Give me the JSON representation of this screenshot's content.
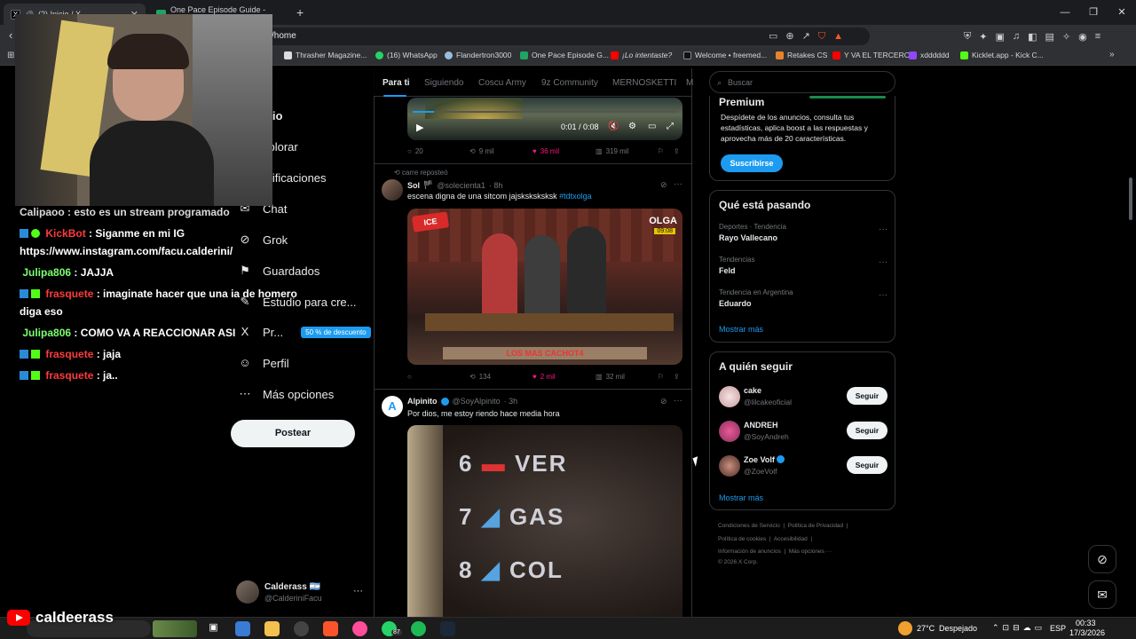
{
  "browser": {
    "tabs": [
      {
        "title": "(2) Inicio / X",
        "active": true
      },
      {
        "title": "One Pace Episode Guide - Google D",
        "active": false
      }
    ],
    "address": "/home",
    "bookmarks": [
      "Thrasher Magazine...",
      "(16) WhatsApp",
      "Flandertron3000",
      "One Pace Episode G...",
      "¡Lo intentaste?",
      "Welcome • freemed...",
      "Retakes CS",
      "Y VA EL TERCERO",
      "xdddddd",
      "Kicklet.app - Kick C..."
    ]
  },
  "nav": {
    "items": [
      {
        "label": "icio",
        "icon": "home-icon"
      },
      {
        "label": "xplorar",
        "icon": "search-icon"
      },
      {
        "label": "otificaciones",
        "icon": "bell-icon"
      },
      {
        "label": "Chat",
        "icon": "chat-icon"
      },
      {
        "label": "Grok",
        "icon": "grok-icon"
      },
      {
        "label": "Guardados",
        "icon": "bookmark-icon"
      },
      {
        "label": "Estudio para cre...",
        "icon": "studio-icon"
      },
      {
        "label": "Pr...",
        "icon": "x-premium-icon"
      },
      {
        "label": "Perfil",
        "icon": "person-icon"
      },
      {
        "label": "Más opciones",
        "icon": "more-circle-icon"
      }
    ],
    "premium_badge": "50 % de descuento",
    "post_button": "Postear",
    "profile": {
      "name": "Calderass 🇦🇷",
      "handle": "@CalderiniFacu"
    }
  },
  "feed": {
    "tabs": [
      "Para ti",
      "Siguiendo",
      "Coscu Army",
      "9z Community",
      "MERNOSKETTI",
      "M"
    ],
    "tweet1": {
      "video_time": "0:01 / 0:08",
      "replies": "20",
      "reposts": "9 mil",
      "likes": "36 mil",
      "views": "319 mil"
    },
    "tweet2": {
      "repost_by": "carre reposteó",
      "name": "Sol",
      "handle": "@solecienta1",
      "time": "· 8h",
      "text": "escena digna de una sitcom jajsksksksksk",
      "hashtag": "#tdtxolga",
      "overlay_brand": "OLGA",
      "overlay_time": "09:08",
      "overlay_caption": "LOS MAS CACHOT4",
      "replies": "",
      "reposts": "134",
      "likes": "2 mil",
      "views": "32 mil"
    },
    "tweet3": {
      "name": "Alpinito",
      "handle": "@SoyAlpinito",
      "time": "· 3h",
      "text": "Por dios, me estoy riendo hace media hora",
      "board": [
        {
          "num": "6",
          "code": "VER"
        },
        {
          "num": "7",
          "code": "GAS"
        },
        {
          "num": "8",
          "code": "COL"
        }
      ]
    }
  },
  "sidebar": {
    "search_placeholder": "Buscar",
    "premium": {
      "title": "Premium",
      "text": "Despídete de los anuncios, consulta tus estadísticas, aplica boost a las respuestas y aprovecha más de 20 características.",
      "button": "Suscribirse"
    },
    "trends": {
      "title": "Qué está pasando",
      "items": [
        {
          "context": "Deportes · Tendencia",
          "name": "Rayo Vallecano"
        },
        {
          "context": "Tendencias",
          "name": "Feld"
        },
        {
          "context": "Tendencia en Argentina",
          "name": "Eduardo"
        }
      ],
      "more": "Mostrar más"
    },
    "follow": {
      "title": "A quién seguir",
      "items": [
        {
          "name": "cake",
          "handle": "@lilcakeoficial",
          "button": "Seguir"
        },
        {
          "name": "ANDREH",
          "handle": "@SoyAndreh",
          "button": "Seguir"
        },
        {
          "name": "Zoe Volf",
          "handle": "@ZoeVolf",
          "button": "Seguir"
        }
      ],
      "more": "Mostrar más"
    },
    "footer": [
      "Condiciones de Servicio",
      "Política de Privacidad",
      "Política de cookies",
      "Accesibilidad",
      "Información de anuncios",
      "Más opciones ···",
      "© 2026 X Corp."
    ]
  },
  "chat_overlay": [
    {
      "user": "",
      "text": "Calipaoo : esto es un stream programado"
    },
    {
      "user": "KickBot",
      "color": "#ff3b3b",
      "text": ": Siganme en mi IG"
    },
    {
      "user": "",
      "text": "https://www.instagram.com/facu.calderini/"
    },
    {
      "user": "Julipa806",
      "color": "#7dff6e",
      "text": ": JAJJA"
    },
    {
      "user": "frasquete",
      "color": "#ff3b3b",
      "text": ": imaginate hacer que una ia de homero"
    },
    {
      "user": "",
      "text": "diga eso"
    },
    {
      "user": "Julipa806",
      "color": "#7dff6e",
      "text": ": COMO VA A REACCIONAR ASI"
    },
    {
      "user": "frasquete",
      "color": "#ff3b3b",
      "text": ": jaja"
    },
    {
      "user": "frasquete",
      "color": "#ff3b3b",
      "text": ": ja.."
    }
  ],
  "stream_watermark": "caldeerass",
  "taskbar": {
    "whatsapp_badge": "87",
    "weather_temp": "27°C",
    "weather_text": "Despejado",
    "lang": "ESP",
    "time": "00:33",
    "date": "17/3/2026"
  },
  "colors": {
    "accent": "#1d9bf0",
    "like": "#f91880",
    "kick_green": "#53fc18"
  }
}
